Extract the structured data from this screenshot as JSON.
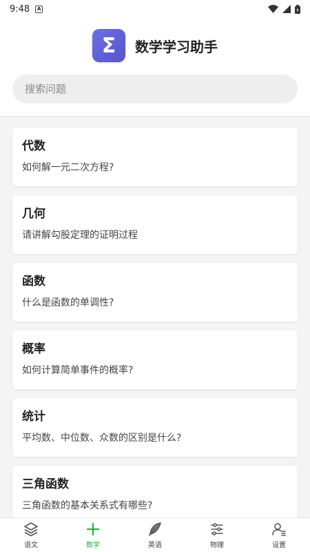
{
  "status_bar": {
    "time": "9:48",
    "icons": [
      "a-notification-icon",
      "wifi-icon",
      "signal-icon",
      "battery-icon"
    ]
  },
  "header": {
    "app_title": "数学学习助手",
    "logo_symbol": "Σ",
    "logo_color": "#5d5ddb"
  },
  "search": {
    "placeholder": "搜索问题",
    "value": ""
  },
  "questions": [
    {
      "category": "代数",
      "question": "如何解一元二次方程?"
    },
    {
      "category": "几何",
      "question": "请讲解勾股定理的证明过程"
    },
    {
      "category": "函数",
      "question": "什么是函数的单调性?"
    },
    {
      "category": "概率",
      "question": "如何计算简单事件的概率?"
    },
    {
      "category": "统计",
      "question": "平均数、中位数、众数的区别是什么?"
    },
    {
      "category": "三角函数",
      "question": "三角函数的基本关系式有哪些?"
    }
  ],
  "tabs": [
    {
      "label": "语文",
      "icon": "layers-icon",
      "active": false
    },
    {
      "label": "数学",
      "icon": "plus-icon",
      "active": true
    },
    {
      "label": "英语",
      "icon": "feather-icon",
      "active": false
    },
    {
      "label": "物理",
      "icon": "sliders-icon",
      "active": false
    },
    {
      "label": "设置",
      "icon": "user-settings-icon",
      "active": false
    }
  ],
  "colors": {
    "active_tab": "#2eae3c",
    "accent": "#5d5ddb"
  }
}
